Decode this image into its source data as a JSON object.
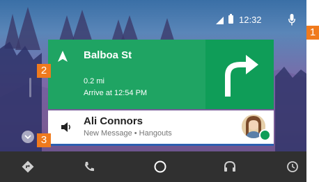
{
  "status_bar": {
    "time": "12:32",
    "icons": [
      "signal-icon",
      "battery-icon",
      "mic-icon"
    ]
  },
  "navigation_card": {
    "street": "Balboa St",
    "distance": "0.2 mi",
    "arrival": "Arrive at 12:54 PM",
    "direction_icon": "navigation-arrow-icon",
    "turn_icon": "turn-right-icon",
    "colors": {
      "card": "#1fa463",
      "turn_panel": "#0f9d58"
    }
  },
  "message_card": {
    "contact": "Ali Connors",
    "subtitle": "New Message • Hangouts",
    "leading_icon": "speaker-icon",
    "badge_icon": "hangouts-icon"
  },
  "bottom_nav": {
    "items": [
      "navigation-icon",
      "phone-icon",
      "home-circle-icon",
      "headphones-icon",
      "clock-icon"
    ]
  },
  "callouts": [
    "1",
    "2",
    "3"
  ],
  "colors": {
    "callout": "#f07a1d",
    "bottom_bar": "#303030",
    "accent": "#2b5fb0"
  }
}
